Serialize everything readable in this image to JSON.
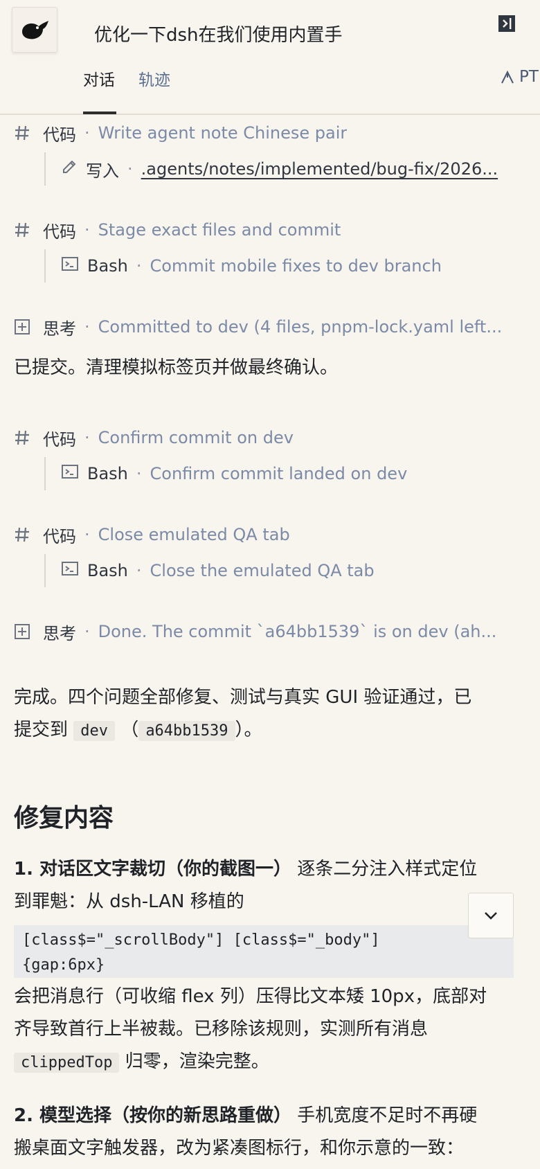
{
  "header": {
    "title": "优化一下dsh在我们使用内置手",
    "tabs": [
      {
        "label": "对话"
      },
      {
        "label": "轨迹"
      }
    ],
    "right_label": "PT"
  },
  "steps": [
    {
      "kind": "代码",
      "desc": "Write agent note Chinese pair",
      "icon": "hash-icon",
      "sub": {
        "kind": "写入",
        "desc": ".agents/notes/implemented/bug-fix/2026...",
        "icon": "pencil-icon"
      }
    },
    {
      "kind": "代码",
      "desc": "Stage exact files and commit",
      "icon": "hash-icon",
      "sub": {
        "kind": "Bash",
        "desc": "Commit mobile fixes to dev branch",
        "icon": "terminal-icon"
      }
    },
    {
      "kind": "思考",
      "desc": "Committed to dev (4 files, pnpm-lock.yaml left...",
      "icon": "expand-icon"
    },
    {
      "kind": "代码",
      "desc": "Confirm commit on dev",
      "icon": "hash-icon",
      "sub": {
        "kind": "Bash",
        "desc": "Confirm commit landed on dev",
        "icon": "terminal-icon"
      }
    },
    {
      "kind": "代码",
      "desc": "Close emulated QA tab",
      "icon": "hash-icon",
      "sub": {
        "kind": "Bash",
        "desc": "Close the emulated QA tab",
        "icon": "terminal-icon"
      }
    },
    {
      "kind": "思考",
      "desc": "Done. The commit `a64bb1539` is on dev (ah...",
      "icon": "expand-icon"
    }
  ],
  "dot": "·",
  "messages": {
    "committed": "已提交。清理模拟标签页并做最终确认。",
    "done_line1": "完成。四个问题全部修复、测试与真实 GUI 验证通过，已",
    "done_prefix": "提交到",
    "done_branch": "dev",
    "done_open": "（",
    "done_hash": "a64bb1539",
    "done_close": "）。"
  },
  "section": {
    "heading": "修复内容",
    "item1_title": "1. 对话区文字裁切（你的截图一）",
    "item1_line1_rest": "逐条二分注入样式定位",
    "item1_line2": "到罪魁：从 dsh-LAN 移植的",
    "item1_code": "[class$=\"_scrollBody\"] [class$=\"_body\"]\n{gap:6px}",
    "item1_after1": "会把消息行（可收缩 flex 列）压得比文本矮 10px，底部对",
    "item1_after2": "齐导致首行上半被裁。已移除该规则，实测所有消息",
    "item1_code_inline": "clippedTop",
    "item1_after3": "归零，渲染完整。",
    "item2_title": "2. 模型选择（按你的新思路重做）",
    "item2_line1_rest": "手机宽度不足时不再硬",
    "item2_line2": "搬桌面文字触发器，改为紧凑图标行，和你示意的一致："
  }
}
